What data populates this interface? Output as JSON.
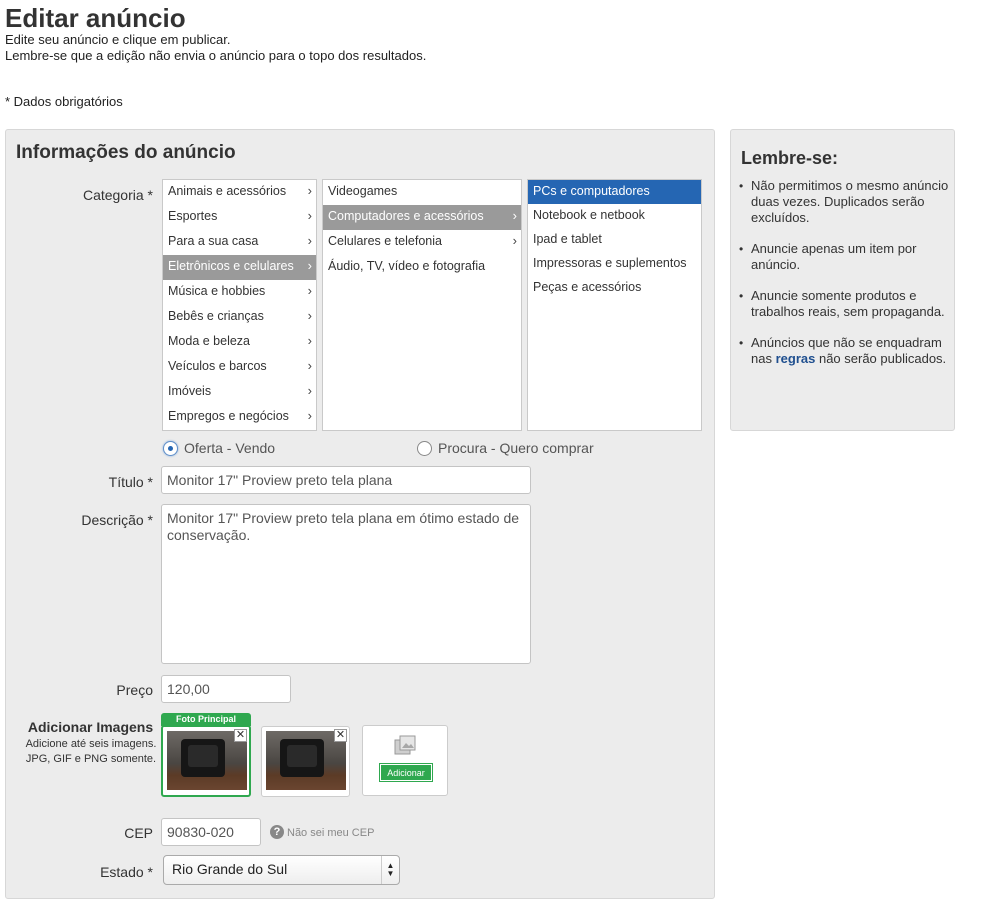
{
  "page": {
    "title": "Editar anúncio",
    "subtitle1": "Edite seu anúncio e clique em publicar.",
    "subtitle2": "Lembre-se que a edição não envia o anúncio para o topo dos resultados.",
    "required_note": "* Dados obrigatórios"
  },
  "form": {
    "section_title": "Informações do anúncio",
    "labels": {
      "categoria": "Categoria *",
      "titulo": "Título *",
      "descricao": "Descrição *",
      "preco": "Preço",
      "cep": "CEP",
      "estado": "Estado *"
    },
    "categories": {
      "level1": [
        {
          "label": "Animais e acessórios"
        },
        {
          "label": "Esportes"
        },
        {
          "label": "Para a sua casa"
        },
        {
          "label": "Eletrônicos e celulares",
          "selected": true
        },
        {
          "label": "Música e hobbies"
        },
        {
          "label": "Bebês e crianças"
        },
        {
          "label": "Moda e beleza"
        },
        {
          "label": "Veículos e barcos"
        },
        {
          "label": "Imóveis"
        },
        {
          "label": "Empregos e negócios"
        }
      ],
      "level2": [
        {
          "label": "Videogames"
        },
        {
          "label": "Computadores e acessórios",
          "selected": true
        },
        {
          "label": "Celulares e telefonia"
        },
        {
          "label": "Áudio, TV, vídeo e fotografia"
        }
      ],
      "level3": [
        {
          "label": "PCs e computadores",
          "selected": true
        },
        {
          "label": "Notebook e netbook"
        },
        {
          "label": "Ipad e tablet"
        },
        {
          "label": "Impressoras e suplementos"
        },
        {
          "label": "Peças e acessórios"
        }
      ]
    },
    "ad_type": {
      "options": [
        "Oferta - Vendo",
        "Procura - Quero comprar"
      ],
      "selected": "Oferta - Vendo"
    },
    "titulo_value": "Monitor 17\" Proview preto tela plana",
    "descricao_value": "Monitor 17\" Proview preto tela plana em ótimo estado de conservação.",
    "preco_value": "120,00",
    "images": {
      "title": "Adicionar Imagens",
      "hint1": "Adicione até seis imagens.",
      "hint2": "JPG, GIF e PNG somente.",
      "main_tag": "Foto Principal",
      "close_glyph": "✕",
      "add_label": "Adicionar"
    },
    "cep_value": "90830-020",
    "cep_help_glyph": "?",
    "cep_help": "Não sei meu CEP",
    "estado_value": "Rio Grande do Sul"
  },
  "sidebar": {
    "title": "Lembre-se:",
    "items": [
      "Não permitimos o mesmo anúncio duas vezes. Duplicados serão excluídos.",
      "Anuncie apenas um item por anúncio.",
      "Anuncie somente produtos e trabalhos reais, sem propaganda."
    ],
    "item4_before": "Anúncios que não se enquadram nas",
    "item4_link": "regras",
    "item4_after": "não serão publicados."
  },
  "colors": {
    "accent_blue": "#2566b3",
    "selected_gray": "#9a9a9a",
    "green": "#2fa84f",
    "panel_bg": "#ececec"
  },
  "icons": [
    "chevron-right-icon",
    "close-icon",
    "add-photo-icon",
    "help-icon",
    "select-arrows-icon"
  ]
}
